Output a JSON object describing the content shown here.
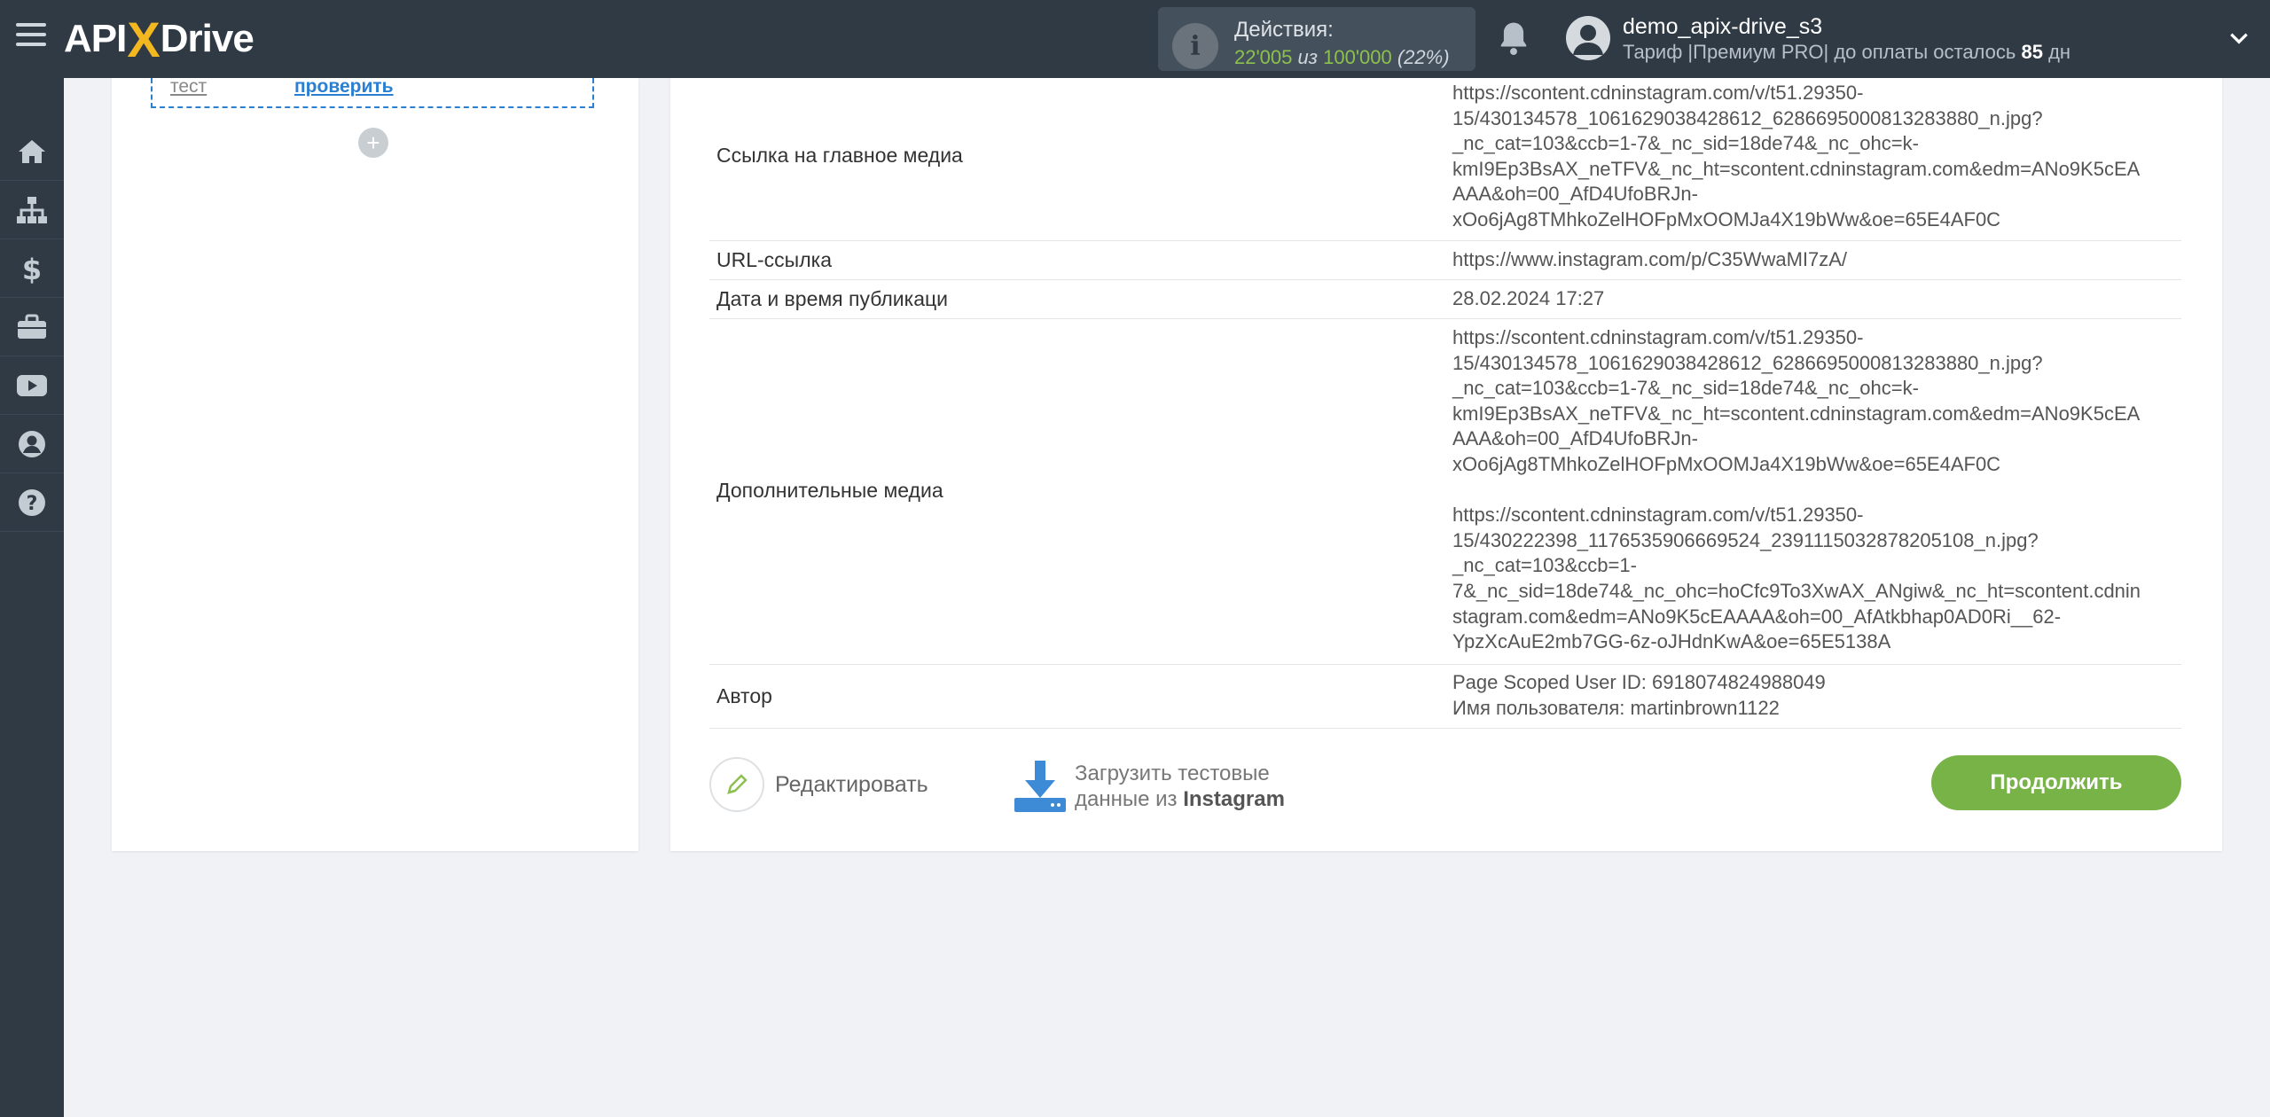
{
  "header": {
    "logo": {
      "left": "API",
      "x": "X",
      "right": "Drive"
    },
    "actions": {
      "title": "Действия:",
      "used": "22'005",
      "of": "из",
      "total": "100'000",
      "percent": "(22%)"
    },
    "user": {
      "name": "demo_apix-drive_s3",
      "plan_prefix": "Тариф |Премиум PRO| до оплаты осталось",
      "days": "85",
      "days_suffix": "дн"
    }
  },
  "sidebar": {
    "items": [
      {
        "name": "home-icon"
      },
      {
        "name": "sitemap-icon"
      },
      {
        "name": "dollar-icon"
      },
      {
        "name": "briefcase-icon"
      },
      {
        "name": "youtube-icon"
      },
      {
        "name": "user-icon"
      },
      {
        "name": "help-icon"
      }
    ]
  },
  "left_panel": {
    "test_label": "тест",
    "verify_link": "проверить",
    "add_symbol": "+"
  },
  "data_rows": [
    {
      "label": "Ссылка на главное медиа",
      "lines": [
        "https://scontent.cdninstagram.com/v/t51.29350-",
        "15/430134578_1061629038428612_6286695000813283880_n.jpg?",
        "_nc_cat=103&ccb=1-7&_nc_sid=18de74&_nc_ohc=k-",
        "kmI9Ep3BsAX_neTFV&_nc_ht=scontent.cdninstagram.com&edm=ANo9K5cEA",
        "AAA&oh=00_AfD4UfoBRJn-",
        "xOo6jAg8TMhkoZelHOFpMxOOMJa4X19bWw&oe=65E4AF0C"
      ]
    },
    {
      "label": "URL-ссылка",
      "lines": [
        "https://www.instagram.com/p/C35WwaMI7zA/"
      ]
    },
    {
      "label": "Дата и время публикаци",
      "lines": [
        "28.02.2024 17:27"
      ]
    },
    {
      "label": "Дополнительные медиа",
      "lines": [
        "https://scontent.cdninstagram.com/v/t51.29350-",
        "15/430134578_1061629038428612_6286695000813283880_n.jpg?",
        "_nc_cat=103&ccb=1-7&_nc_sid=18de74&_nc_ohc=k-",
        "kmI9Ep3BsAX_neTFV&_nc_ht=scontent.cdninstagram.com&edm=ANo9K5cEA",
        "AAA&oh=00_AfD4UfoBRJn-",
        "xOo6jAg8TMhkoZelHOFpMxOOMJa4X19bWw&oe=65E4AF0C",
        "",
        "https://scontent.cdninstagram.com/v/t51.29350-",
        "15/430222398_1176535906669524_2391115032878205108_n.jpg?",
        "_nc_cat=103&ccb=1-",
        "7&_nc_sid=18de74&_nc_ohc=hoCfc9To3XwAX_ANgiw&_nc_ht=scontent.cdnin",
        "stagram.com&edm=ANo9K5cEAAAA&oh=00_AfAtkbhap0AD0Ri__62-",
        "YpzXcAuE2mb7GG-6z-oJHdnKwA&oe=65E5138A"
      ]
    },
    {
      "label": "Автор",
      "lines": [
        "Page Scoped User ID: 6918074824988049",
        "Имя пользователя: martinbrown1122"
      ]
    }
  ],
  "buttons": {
    "edit": "Редактировать",
    "download_line1": "Загрузить тестовые",
    "download_line2_prefix": "данные из",
    "download_source": "Instagram",
    "continue": "Продолжить"
  },
  "colors": {
    "topbar": "#2f3a45",
    "accent_green": "#78b348",
    "link_blue": "#2a7fd1",
    "logo_x": "#f3b81f"
  }
}
